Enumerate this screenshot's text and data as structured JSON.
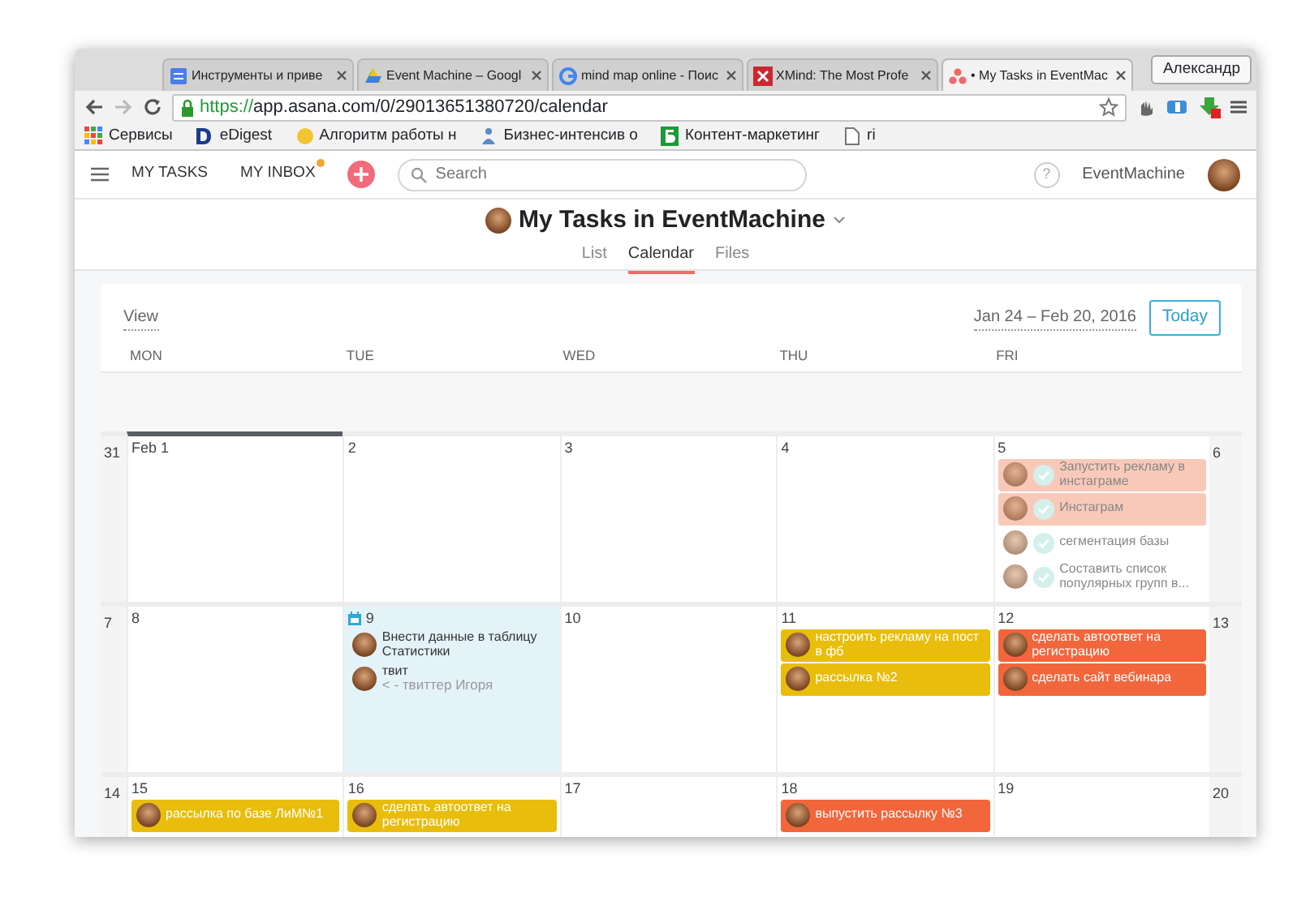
{
  "browser": {
    "tabs": [
      {
        "title": "Инструменты и приве",
        "selected": false
      },
      {
        "title": "Event Machine – Googl",
        "selected": false
      },
      {
        "title": "mind map online - Поис",
        "selected": false
      },
      {
        "title": "XMind: The Most Profe",
        "selected": false
      },
      {
        "title": "• My Tasks in EventMac",
        "selected": true
      }
    ],
    "profile": "Александр",
    "url_scheme": "https://",
    "url_rest": "app.asana.com/0/29013651380720/calendar",
    "bookmarks": [
      "Сервисы",
      "eDigest",
      "Алгоритм работы н",
      "Бизнес-интенсив о",
      "Контент-маркетинг",
      "ri"
    ]
  },
  "app": {
    "nav": [
      {
        "label": "MY TASKS",
        "unread": false
      },
      {
        "label": "MY INBOX",
        "unread": true
      }
    ],
    "search": {
      "placeholder": "Search"
    },
    "help": "?",
    "user": "EventMachine",
    "title": "My Tasks in EventMachine",
    "views": [
      {
        "label": "List",
        "selected": false
      },
      {
        "label": "Calendar",
        "selected": true
      },
      {
        "label": "Files",
        "selected": false
      }
    ],
    "view_menu": "View",
    "date_range": "Jan 24 – Feb 20, 2016",
    "today_button": "Today",
    "weekdays": [
      "MON",
      "TUE",
      "WED",
      "THU",
      "FRI"
    ],
    "weeks": [
      {
        "sun": "31",
        "sat": "6",
        "days": [
          {
            "date": "Feb 1",
            "today": false,
            "current": true
          },
          {
            "date": "2",
            "today": false,
            "current": false
          },
          {
            "date": "3",
            "today": false,
            "current": false
          },
          {
            "date": "4",
            "today": false,
            "current": false
          },
          {
            "date": "5",
            "today": false,
            "current": false,
            "tasks": [
              {
                "text": "Запустить рекламу в инстаграме",
                "completed": true,
                "color": "#f8c9b9"
              },
              {
                "text": "Инстаграм",
                "completed": true,
                "color": "#f8c9b9"
              },
              {
                "text": "сегментация базы",
                "completed": true
              },
              {
                "text": "Составить список популярных групп в...",
                "completed": true
              }
            ]
          }
        ]
      },
      {
        "sun": "7",
        "sat": "13",
        "days": [
          {
            "date": "8",
            "today": false,
            "current": false
          },
          {
            "date": "9",
            "today": true,
            "current": false,
            "tasks": [
              {
                "text": "Внести данные в таблицу Статистики",
                "completed": false
              },
              {
                "text": "твит",
                "note": "< - твиттер Игоря",
                "completed": false
              }
            ]
          },
          {
            "date": "10",
            "today": false,
            "current": false
          },
          {
            "date": "11",
            "today": false,
            "current": false,
            "tasks": [
              {
                "text": "настроить рекламу на пост в фб",
                "completed": false,
                "color": "#e9bd0b"
              },
              {
                "text": "рассылка №2",
                "completed": false,
                "color": "#e9bd0b"
              }
            ]
          },
          {
            "date": "12",
            "today": false,
            "current": false,
            "tasks": [
              {
                "text": "сделать автоответ на регистрацию",
                "completed": false,
                "color": "#f2663b"
              },
              {
                "text": "сделать сайт вебинара",
                "completed": false,
                "color": "#f2663b"
              }
            ]
          }
        ]
      },
      {
        "sun": "14",
        "sat": "20",
        "days": [
          {
            "date": "15",
            "today": false,
            "current": false,
            "tasks": [
              {
                "text": "рассылка по базе ЛиМ№1",
                "completed": false,
                "color": "#e9bd0b"
              }
            ]
          },
          {
            "date": "16",
            "today": false,
            "current": false,
            "tasks": [
              {
                "text": "сделать автоответ на регистрацию",
                "completed": false,
                "color": "#e9bd0b"
              }
            ]
          },
          {
            "date": "17",
            "today": false,
            "current": false
          },
          {
            "date": "18",
            "today": false,
            "current": false,
            "tasks": [
              {
                "text": "выпустить рассылку №3",
                "completed": false,
                "color": "#f2663b"
              }
            ]
          },
          {
            "date": "19",
            "today": false,
            "current": false
          }
        ]
      }
    ]
  }
}
